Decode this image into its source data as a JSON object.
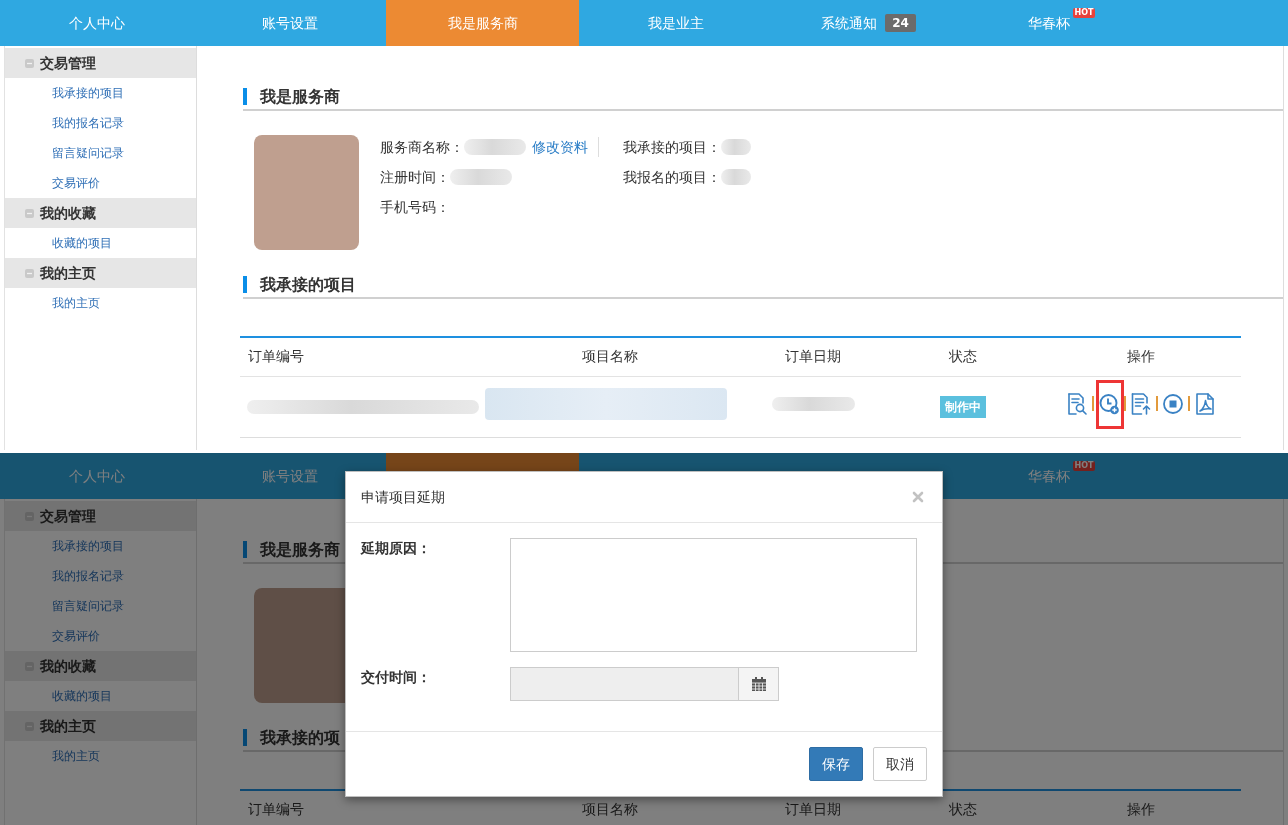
{
  "screens": [
    {
      "nav": {
        "tabs": [
          {
            "label": "个人中心",
            "selected": false
          },
          {
            "label": "账号设置",
            "selected": false
          },
          {
            "label": "我是服务商",
            "selected": true
          },
          {
            "label": "我是业主",
            "selected": false
          },
          {
            "label": "系统通知",
            "selected": false,
            "badge": "24"
          },
          {
            "label": "华春杯",
            "selected": false,
            "tag": "HOT"
          }
        ]
      },
      "sidebar": {
        "groups": [
          {
            "title": "交易管理",
            "expanded": true,
            "items": [
              "我承接的项目",
              "我的报名记录",
              "留言疑问记录",
              "交易评价"
            ]
          },
          {
            "title": "我的收藏",
            "expanded": true,
            "items": [
              "收藏的项目"
            ]
          },
          {
            "title": "我的主页",
            "expanded": true,
            "items": [
              "我的主页"
            ]
          }
        ]
      },
      "sections": [
        {
          "kind": "profile",
          "title": "我是服务商",
          "fields": [
            {
              "label": "服务商名称：",
              "redacted": true,
              "link": "修改资料"
            },
            {
              "label": "我承接的项目：",
              "redacted": true
            },
            {
              "label": "注册时间：",
              "redacted": true
            },
            {
              "label": "我报名的项目：",
              "redacted": true
            },
            {
              "label": "手机号码："
            }
          ]
        },
        {
          "kind": "orders",
          "title": "我承接的项目",
          "table": {
            "columns": [
              "订单编号",
              "项目名称",
              "订单日期",
              "状态",
              "操作"
            ],
            "rows": [
              {
                "cells": [
                  {
                    "kind": "redacted"
                  },
                  {
                    "kind": "redacted"
                  },
                  {
                    "kind": "redacted"
                  },
                  {
                    "kind": "status",
                    "label": "制作中"
                  },
                  {
                    "kind": "actions",
                    "actions": [
                      {
                        "kind": "view",
                        "highlighted": false
                      },
                      {
                        "kind": "extend",
                        "highlighted": true
                      },
                      {
                        "kind": "upload",
                        "highlighted": false
                      },
                      {
                        "kind": "stop",
                        "highlighted": false
                      },
                      {
                        "kind": "pdf",
                        "highlighted": false
                      }
                    ]
                  }
                ]
              }
            ]
          }
        }
      ]
    },
    {
      "nav": {
        "tabs": [
          {
            "label": "个人中心",
            "selected": false
          },
          {
            "label": "账号设置",
            "selected": false
          },
          {
            "selected": true
          },
          {
            "label": "华春杯",
            "selected": false,
            "tag": "HOT"
          }
        ]
      },
      "sidebar": {
        "groups": [
          {
            "title": "交易管理",
            "expanded": true,
            "items": [
              "我承接的项目",
              "我的报名记录",
              "留言疑问记录",
              "交易评价"
            ]
          },
          {
            "title": "我的收藏",
            "expanded": true,
            "items": [
              "收藏的项目"
            ]
          },
          {
            "title": "我的主页",
            "expanded": true,
            "items": [
              "我的主页"
            ]
          }
        ]
      },
      "sections": [
        {
          "kind": "profile",
          "title": "我是服务商"
        },
        {
          "kind": "orders",
          "title": "我承接的项",
          "table": {
            "columns": [
              "订单编号",
              "项目名称",
              "订单日期",
              "状态",
              "操作"
            ]
          }
        }
      ],
      "dialog": {
        "title": "申请项目延期",
        "fields": [
          {
            "kind": "textarea",
            "label": "延期原因："
          },
          {
            "kind": "date",
            "label": "交付时间：",
            "readonly": true
          }
        ],
        "buttons": [
          {
            "kind": "save",
            "label": "保存"
          },
          {
            "kind": "cancel",
            "label": "取消"
          }
        ]
      }
    }
  ]
}
